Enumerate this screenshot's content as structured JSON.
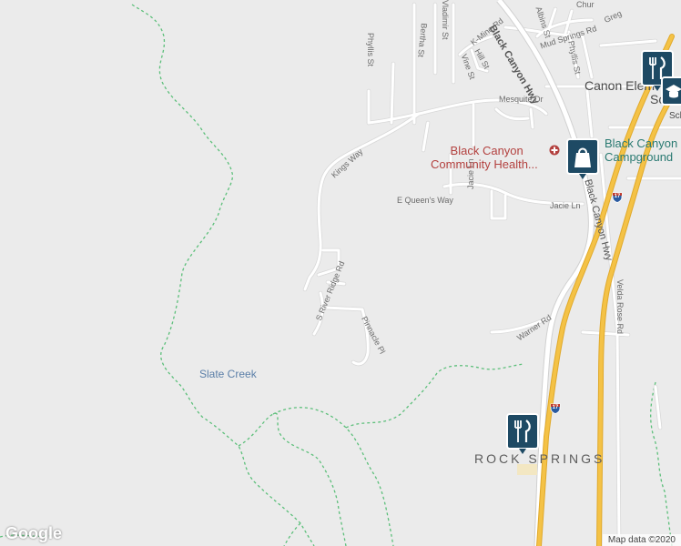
{
  "map": {
    "colors": {
      "land": "#ebebeb",
      "road": "#ffffff",
      "road_edge": "#d6d6d6",
      "highway": "#f4c246",
      "highway_edge": "#e0a92b",
      "trail": "#5cbf7a",
      "poi_red": "#b3413f",
      "poi_teal": "#2a7a72",
      "water_label": "#5b7fa8"
    },
    "streets": {
      "black_canyon_hwy_top": "Black Canyon Hwy",
      "black_canyon_hwy": "Black Canyon Hwy",
      "mud_springs_rd": "Mud Springs Rd",
      "albins_st": "Albins St",
      "phyllis_st_right": "Phyllis St",
      "phyllis_st_left": "Phyllis St",
      "bertha_st": "Bertha St",
      "vladimir_st": "Vladimir St",
      "k_mine_rd": "K-Mine Rd",
      "hill_st": "Hill St",
      "vine_st": "Vine St",
      "mesquite_dr": "Mesquite Dr",
      "kings_way": "Kings Way",
      "e_queens_way": "E Queen's Way",
      "jacie_ln_vertical": "Jacie Ln",
      "jacie_ln": "Jacie Ln",
      "s_river_ridge_rd": "S River Ridge Rd",
      "pinnacle_pl": "Pinnacle Pl",
      "warner_rd": "Warner Rd",
      "velda_rose_rd": "Velda Rose Rd",
      "greg": "Greg",
      "chur": "Chur"
    },
    "places": {
      "canon_elem": "Canon Elem",
      "slate_creek": "Slate Creek",
      "rock_springs": "ROCK SPRINGS",
      "school_partial_1": "Sc",
      "school_partial_2": "Sch"
    },
    "pois": {
      "health_center": "Black Canyon Community Health...",
      "health_center_line1": "Black Canyon",
      "health_center_line2": "Community Health...",
      "campground_line1": "Black Canyon",
      "campground_line2": "Campground"
    },
    "shields": {
      "interstate": "17"
    },
    "icons": [
      "fork-knife-icon",
      "shopping-bag-icon",
      "hospital-icon",
      "school-icon",
      "interstate-shield-icon"
    ],
    "branding": {
      "logo": "Google",
      "attribution": "Map data ©2020"
    }
  }
}
